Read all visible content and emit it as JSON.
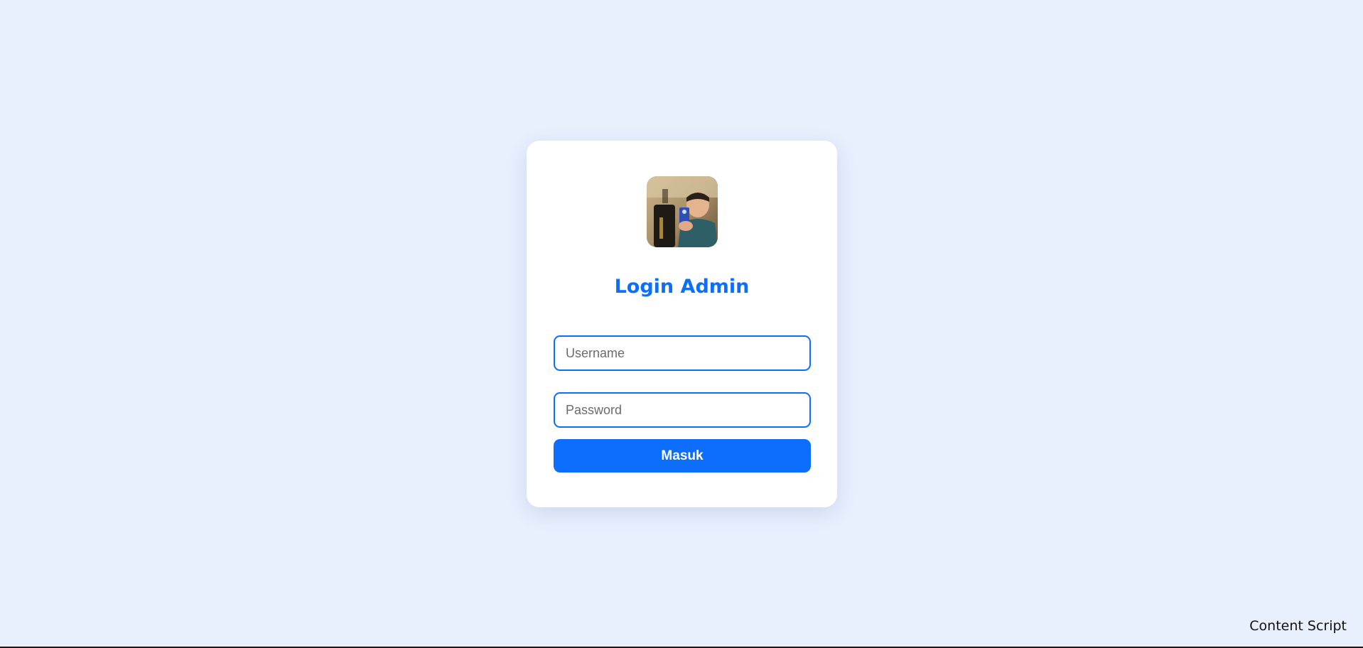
{
  "login": {
    "title": "Login Admin",
    "username_placeholder": "Username",
    "password_placeholder": "Password",
    "submit_label": "Masuk"
  },
  "overlay": {
    "content_script_label": "Content Script"
  },
  "colors": {
    "background": "#e8f0fe",
    "accent": "#0d6efd",
    "card": "#ffffff"
  }
}
